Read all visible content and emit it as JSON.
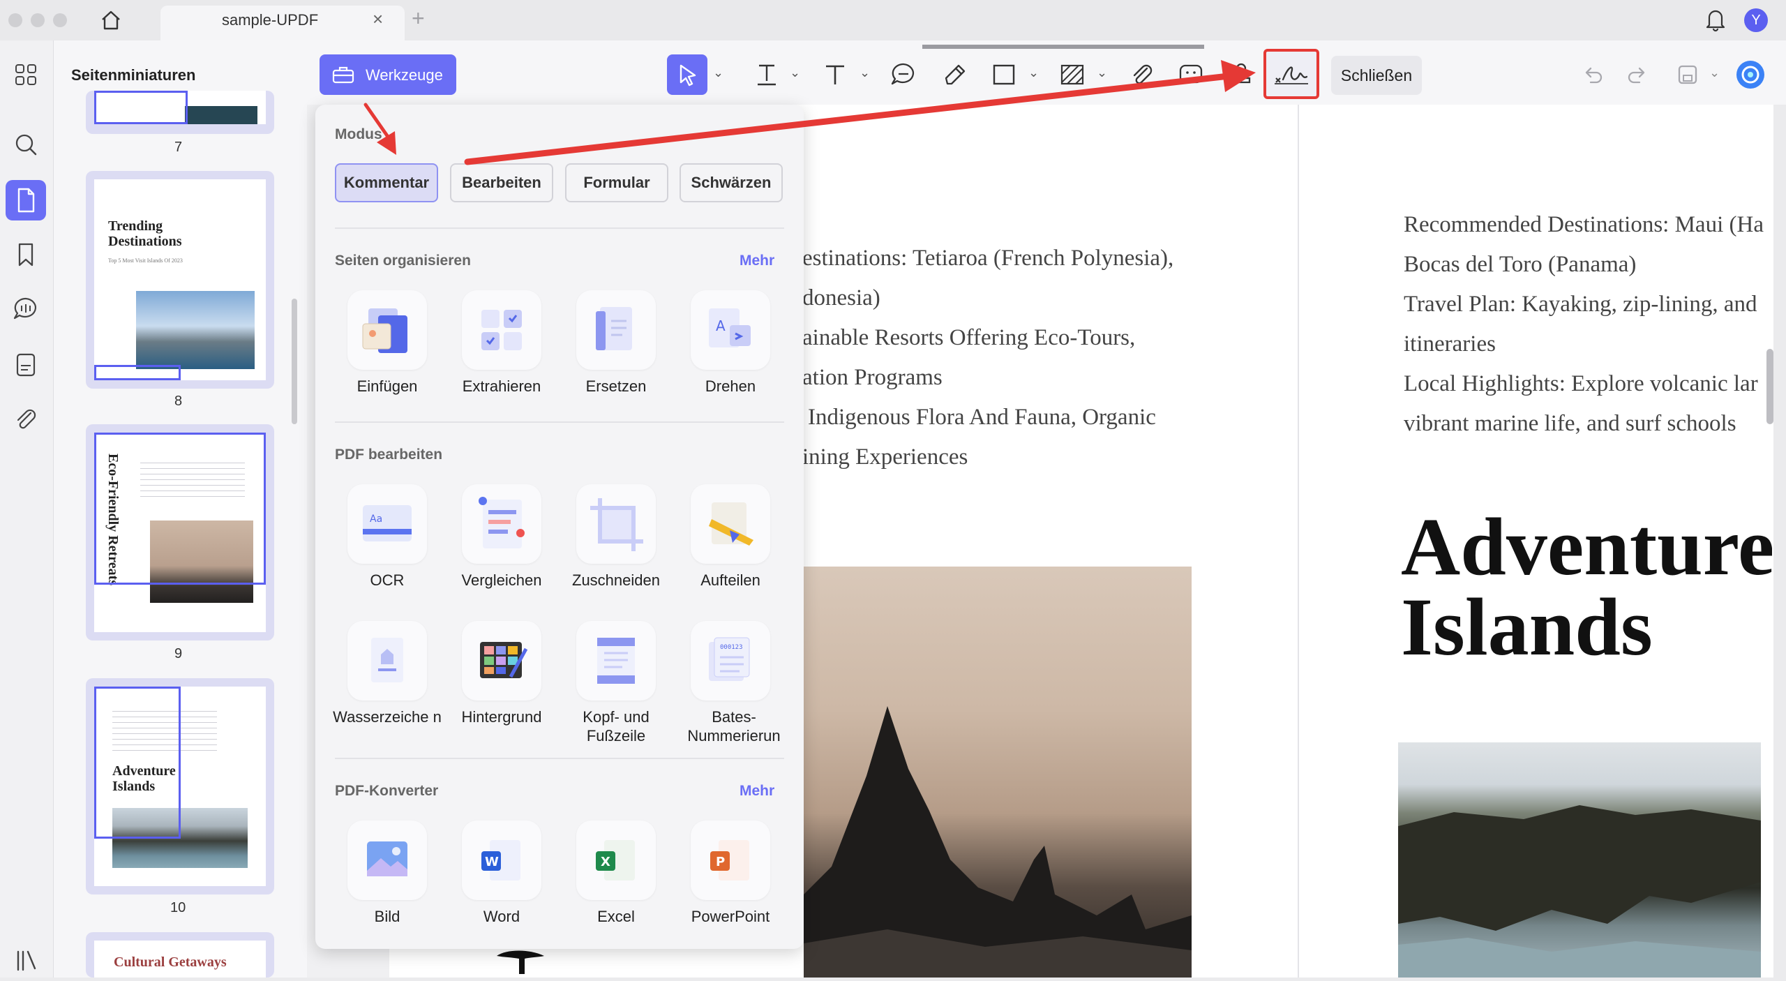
{
  "window": {
    "tab_title": "sample-UPDF",
    "tab_close": "×",
    "tab_add": "+",
    "avatar_initial": "Y"
  },
  "toolbar": {
    "tools_button": "Werkzeuge",
    "close_button": "Schließen"
  },
  "sidebar": {
    "title": "Seitenminiaturen"
  },
  "thumbnails": [
    {
      "page": "7"
    },
    {
      "page": "8",
      "title": "Trending Destinations",
      "subtitle": "Top 5 Most Visit Islands Of 2023"
    },
    {
      "page": "9",
      "title": "Eco-Friendly Retreats"
    },
    {
      "page": "10",
      "title": "Adventure Islands"
    },
    {
      "title": "Cultural Getaways"
    }
  ],
  "popup": {
    "mode_label": "Modus",
    "modes": [
      "Kommentar",
      "Bearbeiten",
      "Formular",
      "Schwärzen"
    ],
    "active_mode": "Kommentar",
    "sections": [
      {
        "title": "Seiten organisieren",
        "more": "Mehr",
        "items": [
          "Einfügen",
          "Extrahieren",
          "Ersetzen",
          "Drehen"
        ]
      },
      {
        "title": "PDF bearbeiten",
        "more": "",
        "items": [
          "OCR",
          "Vergleichen",
          "Zuschneiden",
          "Aufteilen",
          "Wasserzeiche n",
          "Hintergrund",
          "Kopf- und Fußzeile",
          "Bates-Nummerierun"
        ]
      },
      {
        "title": "PDF-Konverter",
        "more": "Mehr",
        "items": [
          "Bild",
          "Word",
          "Excel",
          "PowerPoint"
        ]
      }
    ]
  },
  "document": {
    "left_lines": [
      "estinations: Tetiaroa (French Polynesia),",
      "donesia)",
      "ainable Resorts Offering Eco-Tours,",
      "ation Programs",
      "Indigenous Flora And Fauna, Organic",
      "ining Experiences"
    ],
    "right_lines": [
      "Recommended Destinations: Maui (Ha",
      "Bocas del Toro (Panama)",
      "Travel Plan: Kayaking, zip-lining, and",
      "itineraries",
      "Local Highlights: Explore volcanic lar",
      "vibrant marine life, and surf schools"
    ],
    "heading_line1": "Adventure",
    "heading_line2": "Islands"
  },
  "colors": {
    "accent": "#6a6ef5",
    "annotation_red": "#e53935"
  }
}
